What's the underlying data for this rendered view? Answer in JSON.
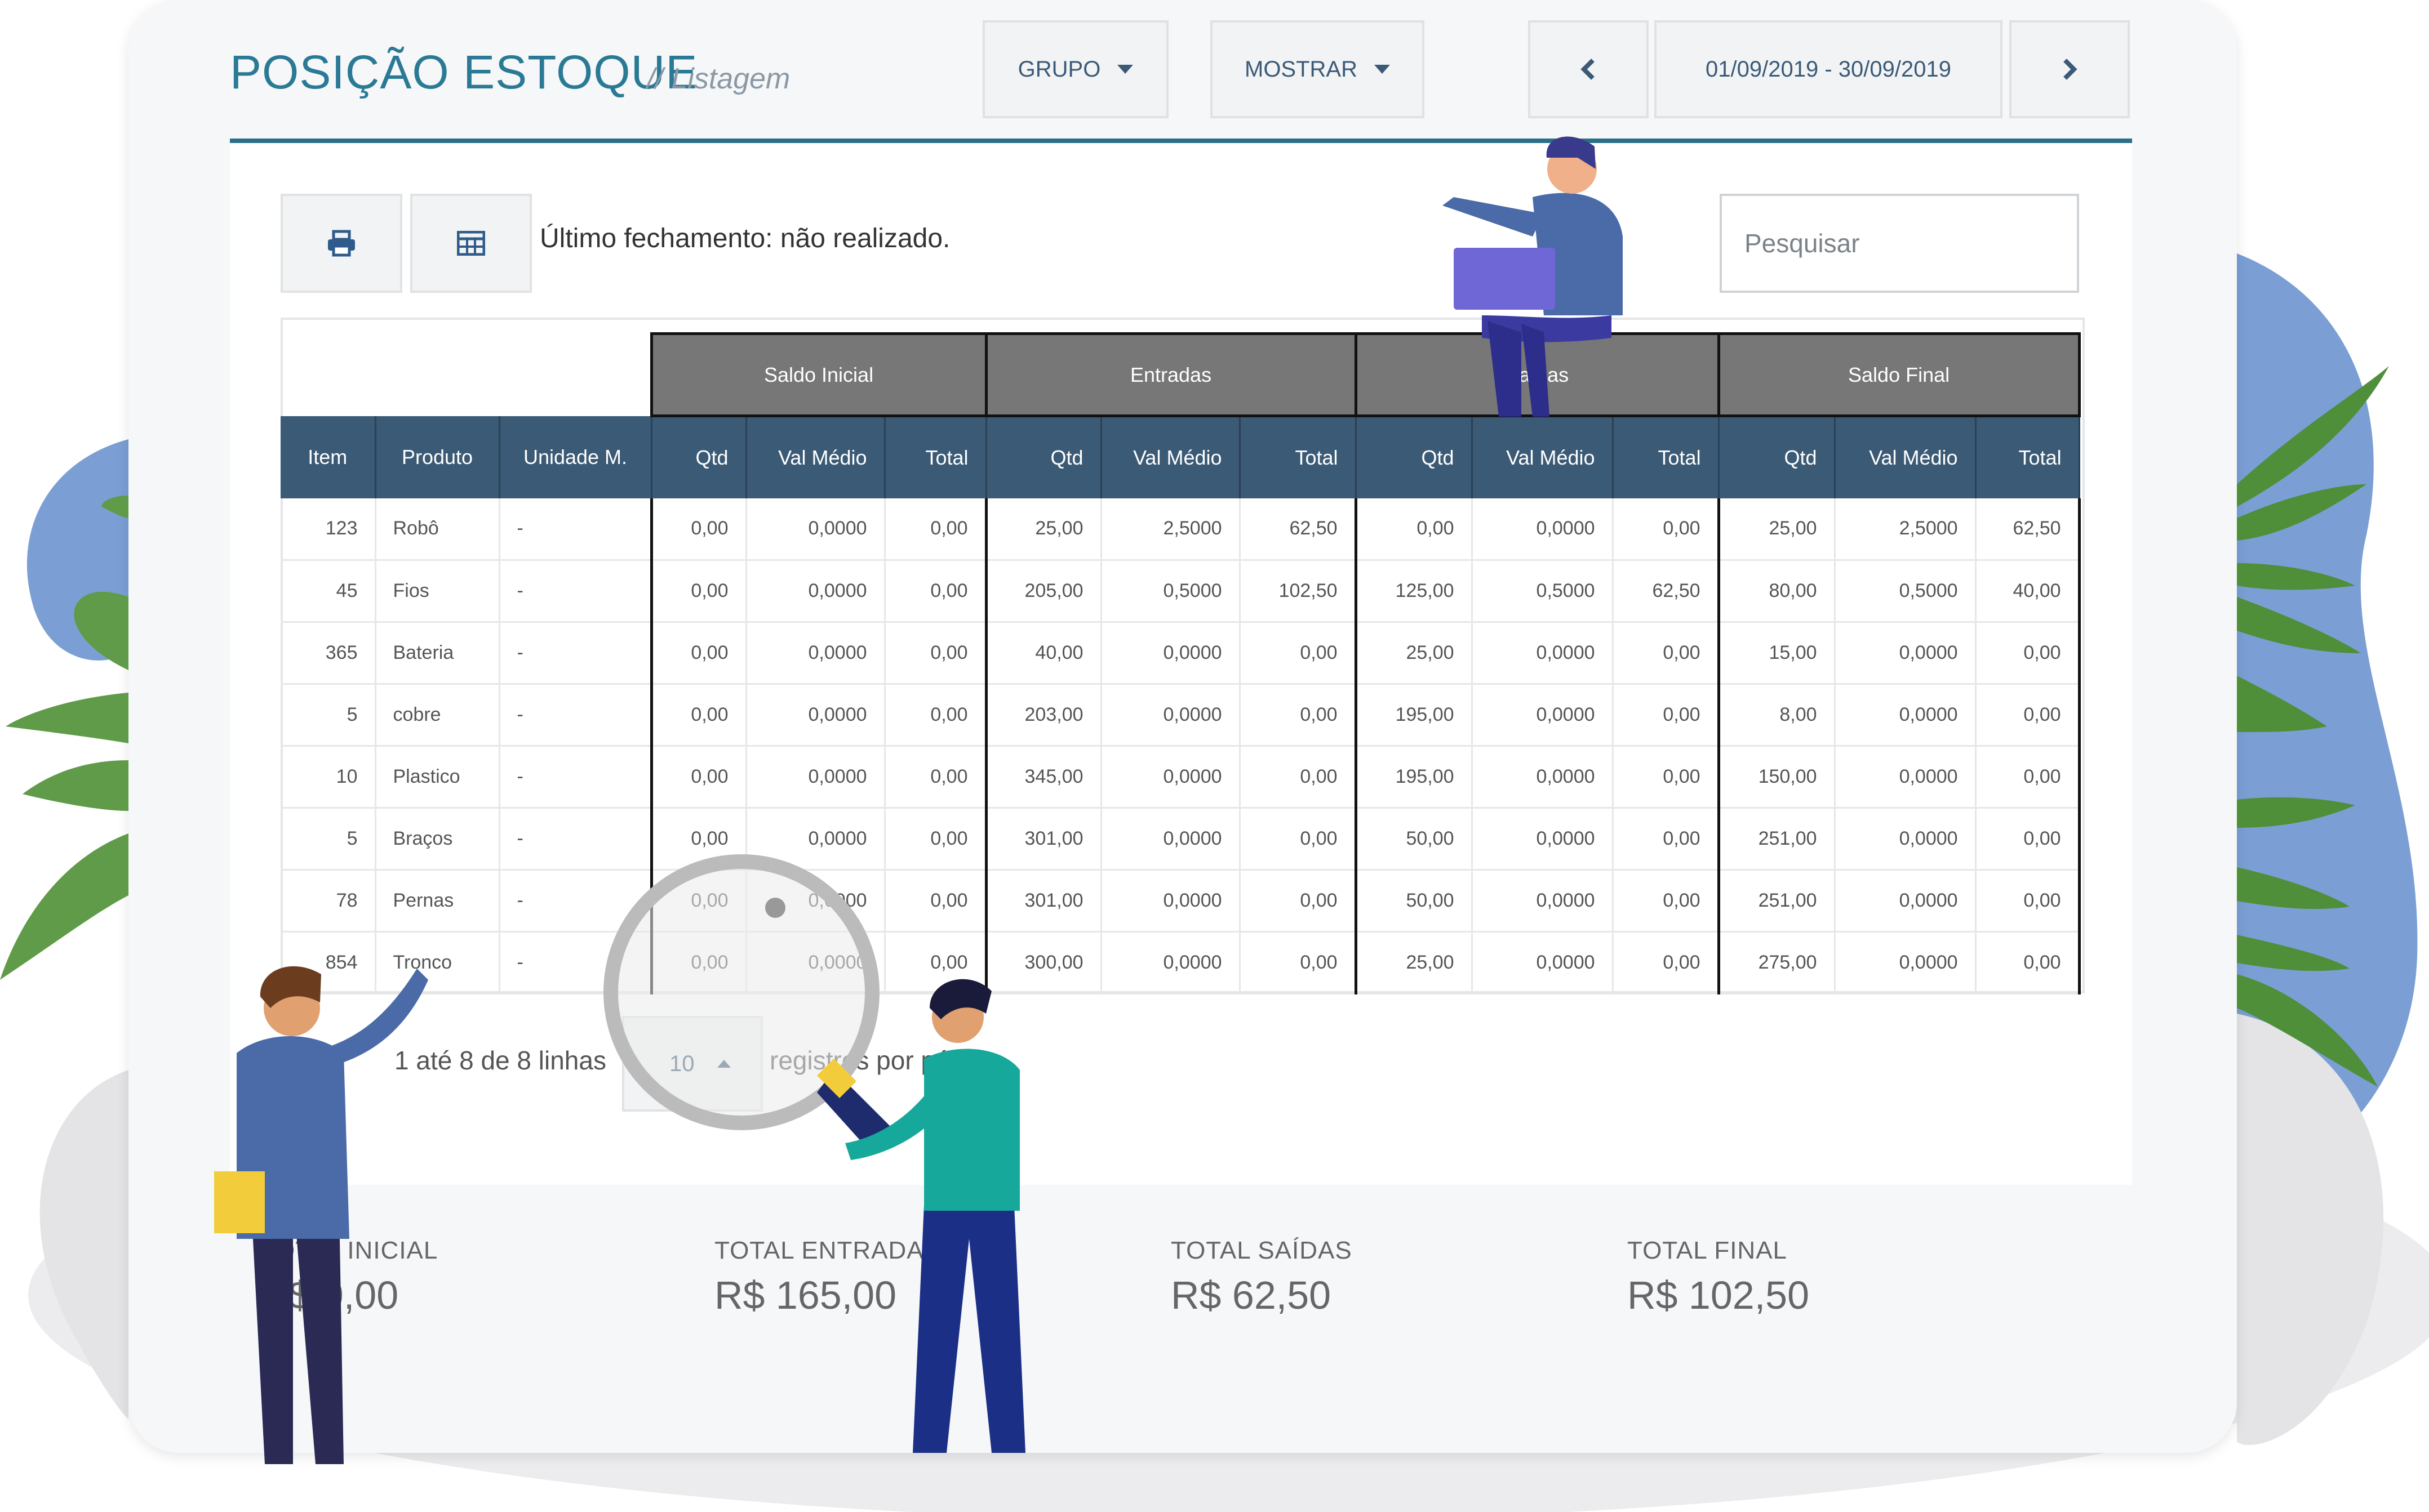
{
  "header": {
    "title": "POSIÇÃO ESTOQUE",
    "subtitle": "// Listagem",
    "group_button": "GRUPO",
    "show_button": "MOSTRAR",
    "date_range": "01/09/2019 - 30/09/2019"
  },
  "toolbar": {
    "last_close": "Último fechamento: não realizado.",
    "search_placeholder": "Pesquisar"
  },
  "table": {
    "groups": [
      "Saldo Inicial",
      "Entradas",
      "Saídas",
      "Saldo Final"
    ],
    "columns": [
      "Item",
      "Produto",
      "Unidade M.",
      "Qtd",
      "Val Médio",
      "Total",
      "Qtd",
      "Val Médio",
      "Total",
      "Qtd",
      "Val Médio",
      "Total",
      "Qtd",
      "Val Médio",
      "Total"
    ],
    "rows": [
      [
        "123",
        "Robô",
        "-",
        "0,00",
        "0,0000",
        "0,00",
        "25,00",
        "2,5000",
        "62,50",
        "0,00",
        "0,0000",
        "0,00",
        "25,00",
        "2,5000",
        "62,50"
      ],
      [
        "45",
        "Fios",
        "-",
        "0,00",
        "0,0000",
        "0,00",
        "205,00",
        "0,5000",
        "102,50",
        "125,00",
        "0,5000",
        "62,50",
        "80,00",
        "0,5000",
        "40,00"
      ],
      [
        "365",
        "Bateria",
        "-",
        "0,00",
        "0,0000",
        "0,00",
        "40,00",
        "0,0000",
        "0,00",
        "25,00",
        "0,0000",
        "0,00",
        "15,00",
        "0,0000",
        "0,00"
      ],
      [
        "5",
        "cobre",
        "-",
        "0,00",
        "0,0000",
        "0,00",
        "203,00",
        "0,0000",
        "0,00",
        "195,00",
        "0,0000",
        "0,00",
        "8,00",
        "0,0000",
        "0,00"
      ],
      [
        "10",
        "Plastico",
        "-",
        "0,00",
        "0,0000",
        "0,00",
        "345,00",
        "0,0000",
        "0,00",
        "195,00",
        "0,0000",
        "0,00",
        "150,00",
        "0,0000",
        "0,00"
      ],
      [
        "5",
        "Braços",
        "-",
        "0,00",
        "0,0000",
        "0,00",
        "301,00",
        "0,0000",
        "0,00",
        "50,00",
        "0,0000",
        "0,00",
        "251,00",
        "0,0000",
        "0,00"
      ],
      [
        "78",
        "Pernas",
        "-",
        "0,00",
        "0,0000",
        "0,00",
        "301,00",
        "0,0000",
        "0,00",
        "50,00",
        "0,0000",
        "0,00",
        "251,00",
        "0,0000",
        "0,00"
      ],
      [
        "854",
        "Tronco",
        "-",
        "0,00",
        "0,0000",
        "0,00",
        "300,00",
        "0,0000",
        "0,00",
        "25,00",
        "0,0000",
        "0,00",
        "275,00",
        "0,0000",
        "0,00"
      ]
    ]
  },
  "pagination": {
    "summary": "1 até 8 de 8 linhas",
    "page_size": "10",
    "per_page_label": "registros por página"
  },
  "totals": [
    {
      "label": "TOTAL INICIAL",
      "value": "R$ 0,00"
    },
    {
      "label": "TOTAL ENTRADAS",
      "value": "R$ 165,00"
    },
    {
      "label": "TOTAL SAÍDAS",
      "value": "R$ 62,50"
    },
    {
      "label": "TOTAL FINAL",
      "value": "R$ 102,50"
    }
  ],
  "icons": [
    "print-icon",
    "table-icon",
    "chevron-left-icon",
    "chevron-right-icon",
    "caret-down-icon",
    "caret-up-icon"
  ],
  "colors": {
    "accent": "#2a7a95",
    "header_row": "#3b5a75",
    "group_row": "#777777",
    "blob_blue": "#7b9fd4",
    "leaf_green": "#4f8f3a"
  }
}
